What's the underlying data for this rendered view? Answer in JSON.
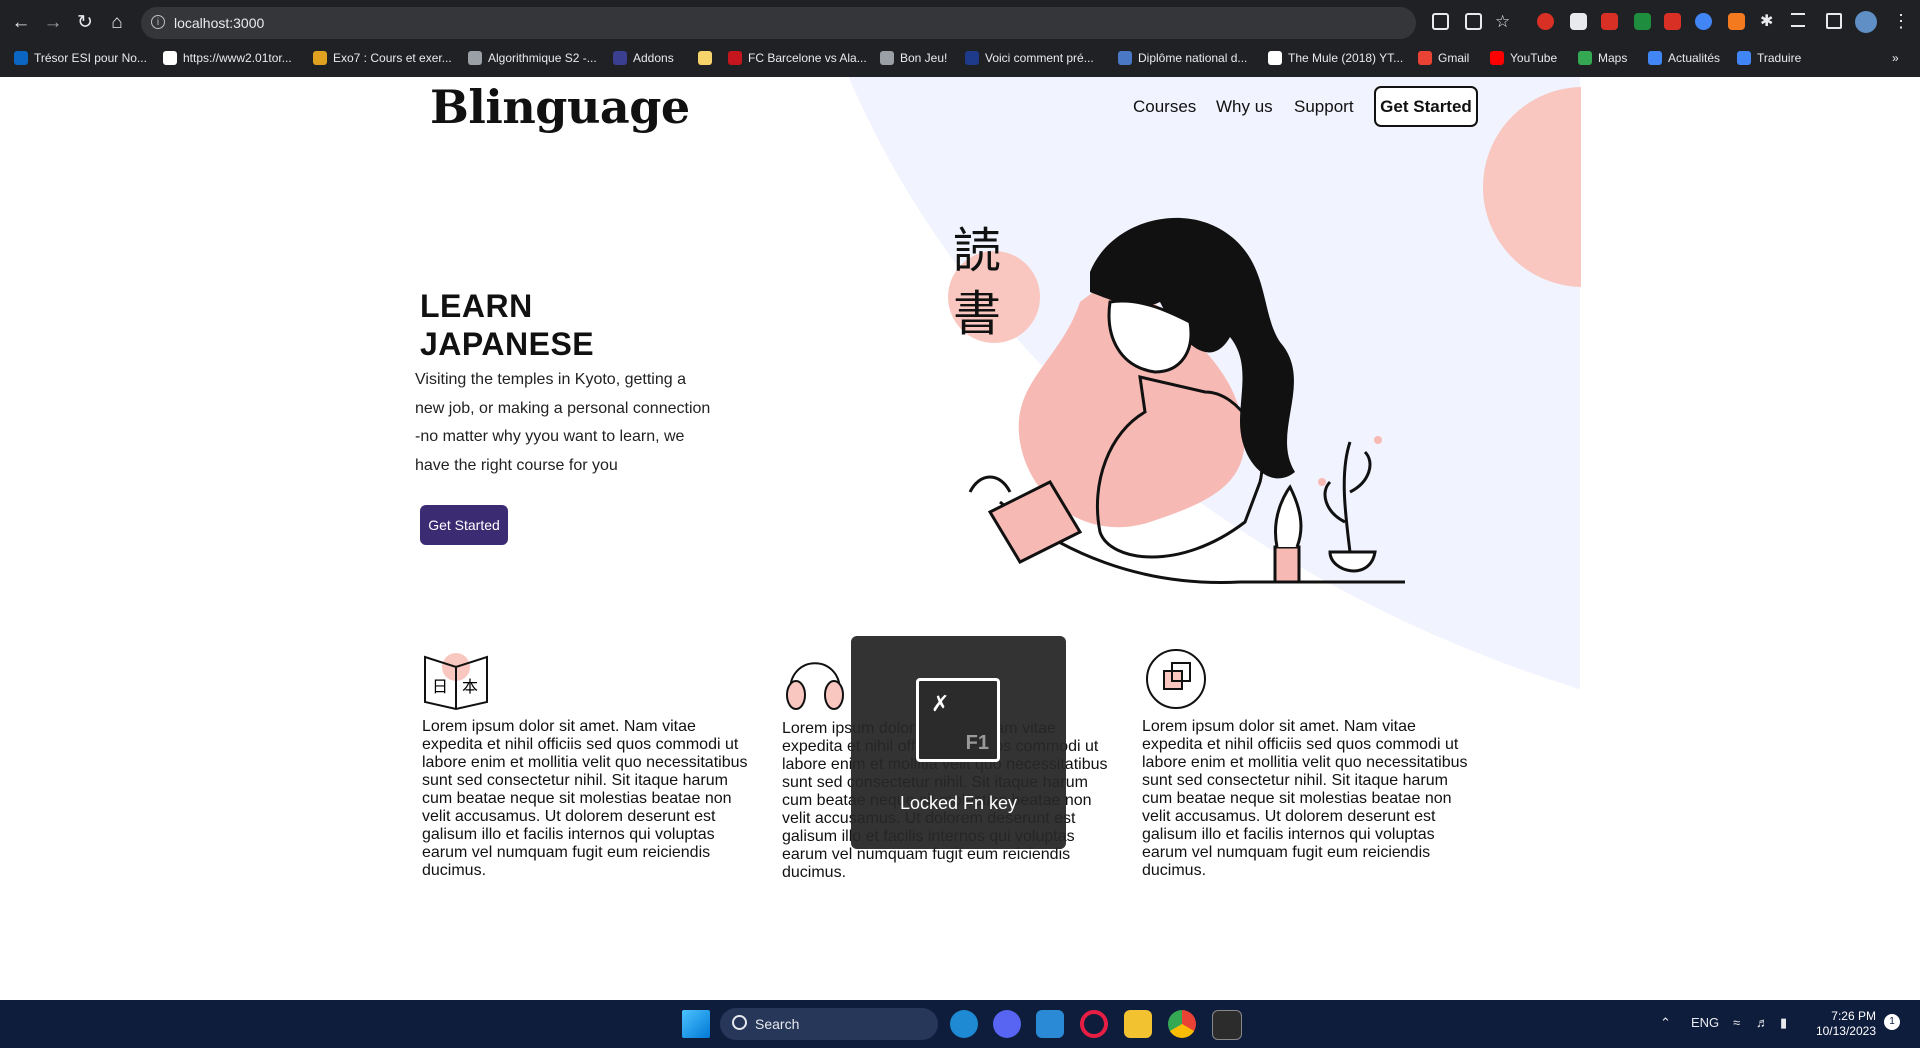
{
  "browser": {
    "url": "localhost:3000",
    "bookmarks": [
      {
        "label": "Trésor ESI pour No...",
        "color": "#0a66c2"
      },
      {
        "label": "https://www2.01tor...",
        "color": "#ffffff"
      },
      {
        "label": "Exo7 : Cours et exer...",
        "color": "#e0a020"
      },
      {
        "label": "Algorithmique S2 -...",
        "color": "#9aa0a6"
      },
      {
        "label": "Addons",
        "color": "#3b3f8f"
      },
      {
        "label": "",
        "color": "#f6d36b"
      },
      {
        "label": "FC Barcelone vs Ala...",
        "color": "#c4161c"
      },
      {
        "label": "Bon Jeu!",
        "color": "#9aa0a6"
      },
      {
        "label": "Voici comment pré...",
        "color": "#1e3a8a"
      },
      {
        "label": "Diplôme national d...",
        "color": "#4a78c4"
      },
      {
        "label": "The Mule (2018) YT...",
        "color": "#ffffff"
      },
      {
        "label": "Gmail",
        "color": "#ea4335"
      },
      {
        "label": "YouTube",
        "color": "#ff0000"
      },
      {
        "label": "Maps",
        "color": "#34a853"
      },
      {
        "label": "Actualités",
        "color": "#4285f4"
      },
      {
        "label": "Traduire",
        "color": "#4285f4"
      }
    ]
  },
  "site": {
    "logo": "Blinguage",
    "nav": [
      "Courses",
      "Why us",
      "Support"
    ],
    "nav_cta": "Get Started",
    "hero_title_line1": "LEARN",
    "hero_title_line2": "JAPANESE",
    "hero_text": "Visiting the temples in Kyoto, getting a new job, or making a personal connection -no matter why yyou want to learn, we have the right course for you",
    "hero_cta": "Get Started",
    "kanji": "読書",
    "features": [
      {
        "icon": "book-icon",
        "text": "Lorem ipsum dolor sit amet. Nam vitae expedita et nihil officiis sed quos commodi ut labore enim et mollitia velit quo necessitatibus sunt sed consectetur nihil. Sit itaque harum cum beatae neque sit molestias beatae non velit accusamus. Ut dolorem deserunt est galisum illo et facilis internos qui voluptas earum vel numquam fugit eum reiciendis ducimus."
      },
      {
        "icon": "headphones-icon",
        "text": "Lorem ipsum dolor sit amet. Nam vitae expedita et nihil officiis sed quos commodi ut labore enim et mollitia velit quo necessitatibus sunt sed consectetur nihil. Sit itaque harum cum beatae neque sit molestias beatae non velit accusamus. Ut dolorem deserunt est galisum illo et facilis internos qui voluptas earum vel numquam fugit eum reiciendis ducimus."
      },
      {
        "icon": "translate-cycle-icon",
        "text": "Lorem ipsum dolor sit amet. Nam vitae expedita et nihil officiis sed quos commodi ut labore enim et mollitia velit quo necessitatibus sunt sed consectetur nihil. Sit itaque harum cum beatae neque sit molestias beatae non velit accusamus. Ut dolorem deserunt est galisum illo et facilis internos qui voluptas earum vel numquam fugit eum reiciendis ducimus."
      }
    ],
    "colors": {
      "accent": "#3a2b72",
      "pink": "#f9c7c0",
      "bg_shape": "#f1f3fe"
    }
  },
  "overlay": {
    "key": "F1",
    "label": "Locked Fn key"
  },
  "taskbar": {
    "search": "Search",
    "lang": "ENG",
    "time": "7:26 PM",
    "date": "10/13/2023",
    "notifications": "1"
  }
}
